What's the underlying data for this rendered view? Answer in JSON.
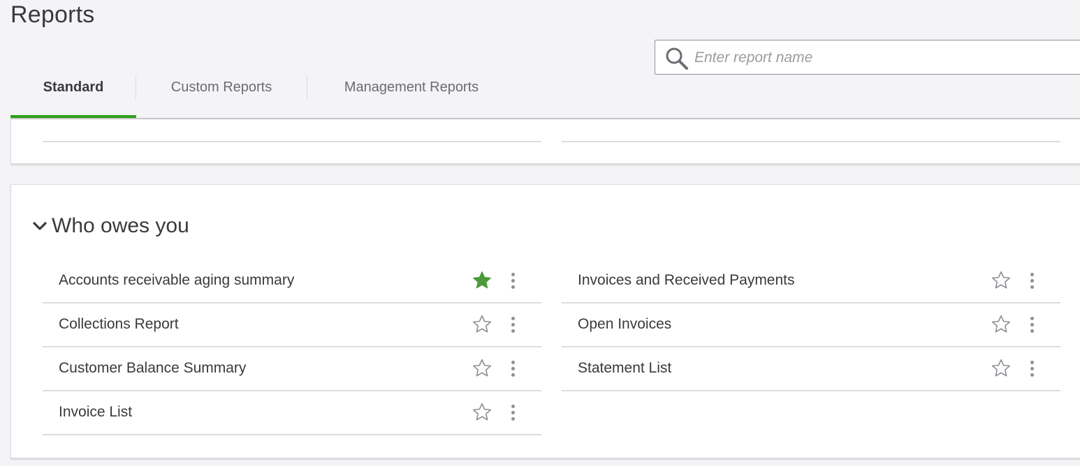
{
  "page": {
    "title": "Reports"
  },
  "search": {
    "placeholder": "Enter report name",
    "icon": "search-icon"
  },
  "tabs": [
    {
      "label": "Standard",
      "active": true
    },
    {
      "label": "Custom Reports",
      "active": false
    },
    {
      "label": "Management Reports",
      "active": false
    }
  ],
  "colors": {
    "accent": "#2ca01c",
    "favorite_star": "#4a9a3a",
    "text": "#393a3d"
  },
  "section": {
    "title": "Who owes you",
    "expanded": true,
    "left_items": [
      {
        "label": "Accounts receivable aging summary",
        "favorite": true
      },
      {
        "label": "Collections Report",
        "favorite": false
      },
      {
        "label": "Customer Balance Summary",
        "favorite": false
      },
      {
        "label": "Invoice List",
        "favorite": false
      }
    ],
    "right_items": [
      {
        "label": "Invoices and Received Payments",
        "favorite": false
      },
      {
        "label": "Open Invoices",
        "favorite": false
      },
      {
        "label": "Statement List",
        "favorite": false
      }
    ]
  }
}
